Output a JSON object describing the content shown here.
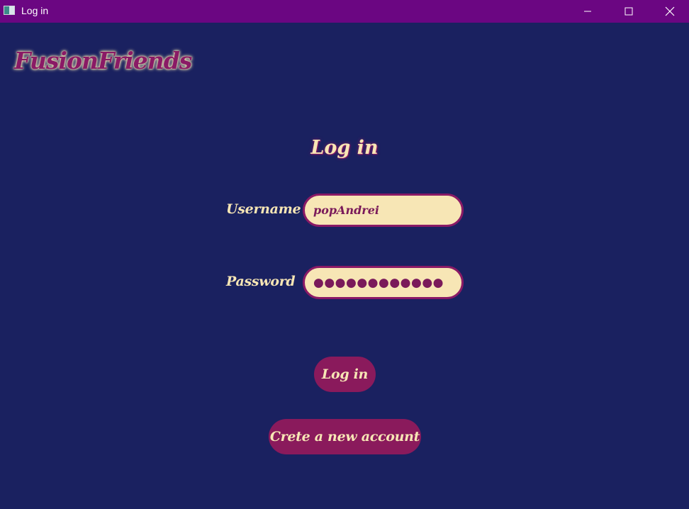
{
  "window": {
    "title": "Log in",
    "controls": [
      "minimize-icon",
      "maximize-icon",
      "close-icon"
    ]
  },
  "app": {
    "logo": "FusionFriends"
  },
  "form": {
    "heading": "Log in",
    "username_label": "Username",
    "username_value": "popAndrei",
    "password_label": "Password",
    "password_value": "●●●●●●●●●●●●",
    "login_button": "Log in",
    "create_account_button": "Crete a new account"
  },
  "colors": {
    "titlebar": "#6b0682",
    "background": "#1a2160",
    "accent": "#8a1a5c",
    "cream": "#f7e6b5"
  }
}
